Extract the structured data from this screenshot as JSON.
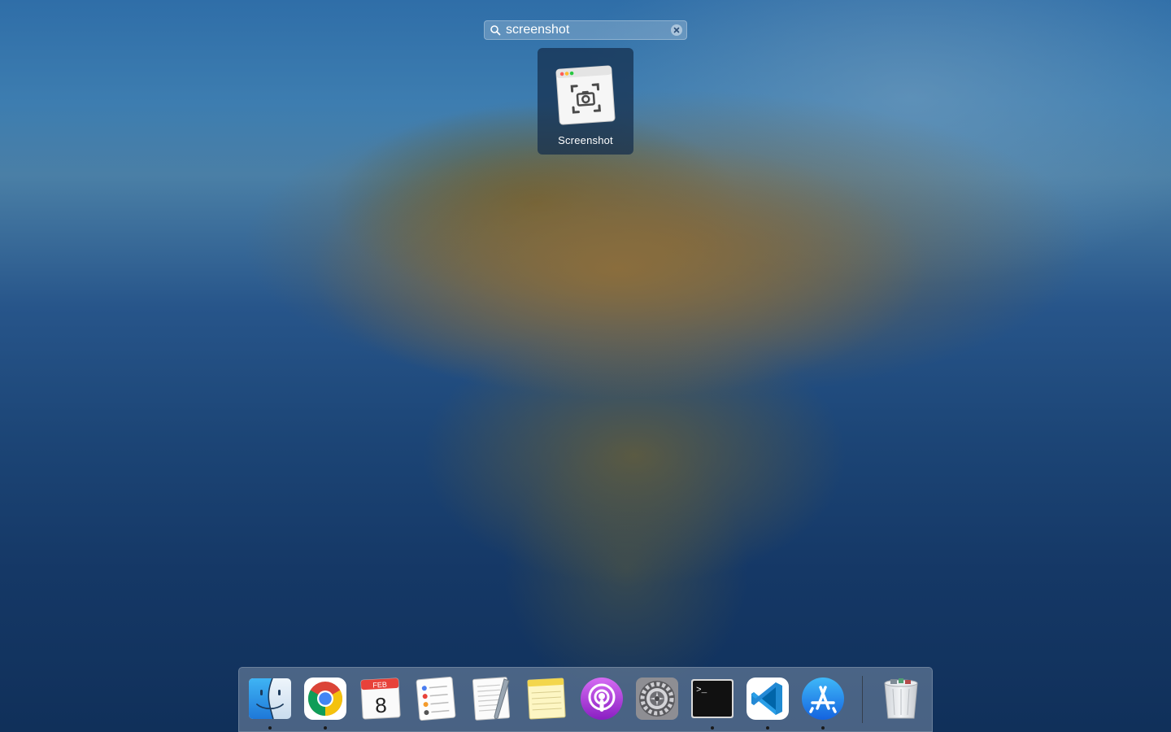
{
  "search": {
    "value": "screenshot"
  },
  "results": [
    {
      "label": "Screenshot",
      "icon": "screenshot-app-icon"
    }
  ],
  "dock": {
    "items": [
      {
        "name": "finder",
        "icon": "finder-icon",
        "running": true
      },
      {
        "name": "chrome",
        "icon": "chrome-icon",
        "running": true
      },
      {
        "name": "calendar",
        "icon": "calendar-icon",
        "running": false,
        "month": "FEB",
        "day": "8"
      },
      {
        "name": "reminders",
        "icon": "reminders-icon",
        "running": false
      },
      {
        "name": "textedit",
        "icon": "textedit-icon",
        "running": false
      },
      {
        "name": "notes",
        "icon": "notes-icon",
        "running": false
      },
      {
        "name": "podcasts",
        "icon": "podcasts-icon",
        "running": false
      },
      {
        "name": "system-preferences",
        "icon": "system-preferences-icon",
        "running": false
      },
      {
        "name": "terminal",
        "icon": "terminal-icon",
        "running": true,
        "prompt": ">_"
      },
      {
        "name": "vscode",
        "icon": "vscode-icon",
        "running": true
      },
      {
        "name": "app-store",
        "icon": "app-store-icon",
        "running": true
      },
      {
        "name": "trash",
        "icon": "trash-icon",
        "running": false
      }
    ]
  }
}
